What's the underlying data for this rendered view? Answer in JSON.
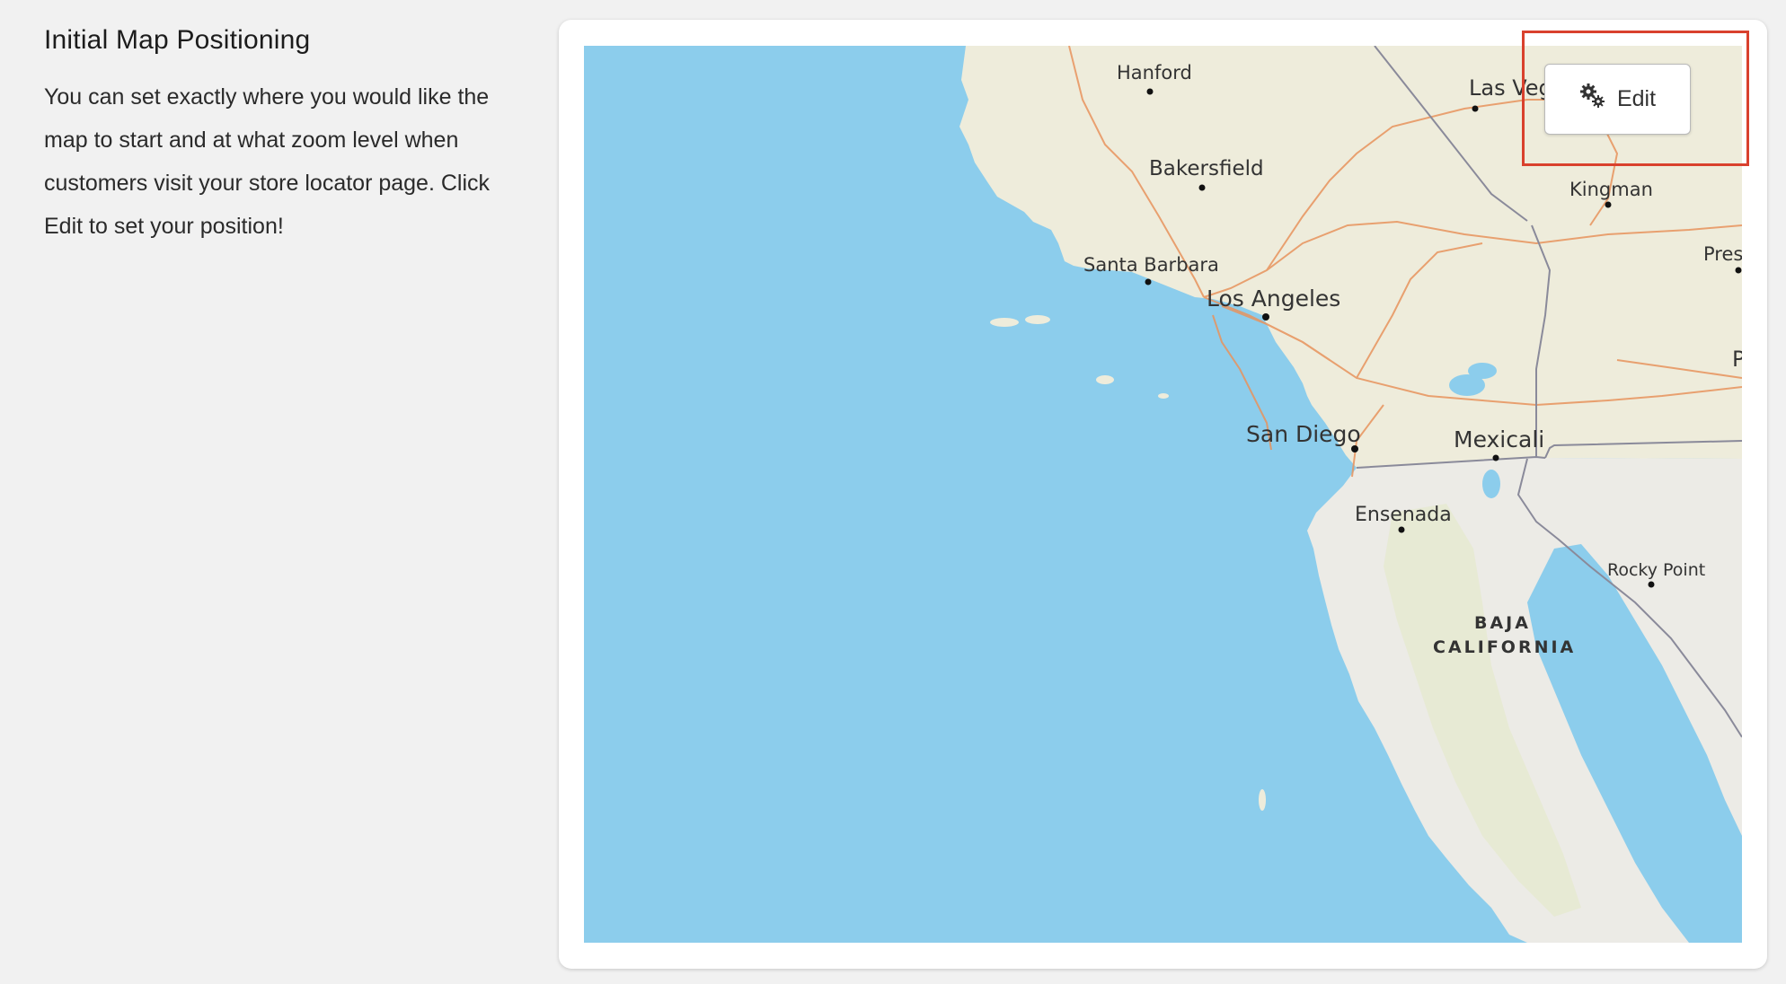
{
  "section": {
    "title": "Initial Map Positioning",
    "description": "You can set exactly where you would like the map to start and at what zoom level when customers visit your store locator page. Click Edit to set your position!"
  },
  "map": {
    "colors": {
      "water": "#8ccdec",
      "land": "#eeecdb",
      "mexico_land": "#ecebe6",
      "road": "#e8935d",
      "border": "#8a8a9a"
    },
    "labels": {
      "hanford": "Hanford",
      "las_vegas": "Las Veg",
      "bakersfield": "Bakersfield",
      "kingman": "Kingman",
      "pres": "Pres",
      "santa_barbara": "Santa Barbara",
      "los_angeles": "Los Angeles",
      "p": "P",
      "san_diego": "San Diego",
      "mexicali": "Mexicali",
      "ensenada": "Ensenada",
      "rocky_point": "Rocky Point",
      "baja_1": "BAJA",
      "baja_2": "CALIFORNIA"
    }
  },
  "edit_button": {
    "label": "Edit",
    "icon": "gears-icon"
  }
}
